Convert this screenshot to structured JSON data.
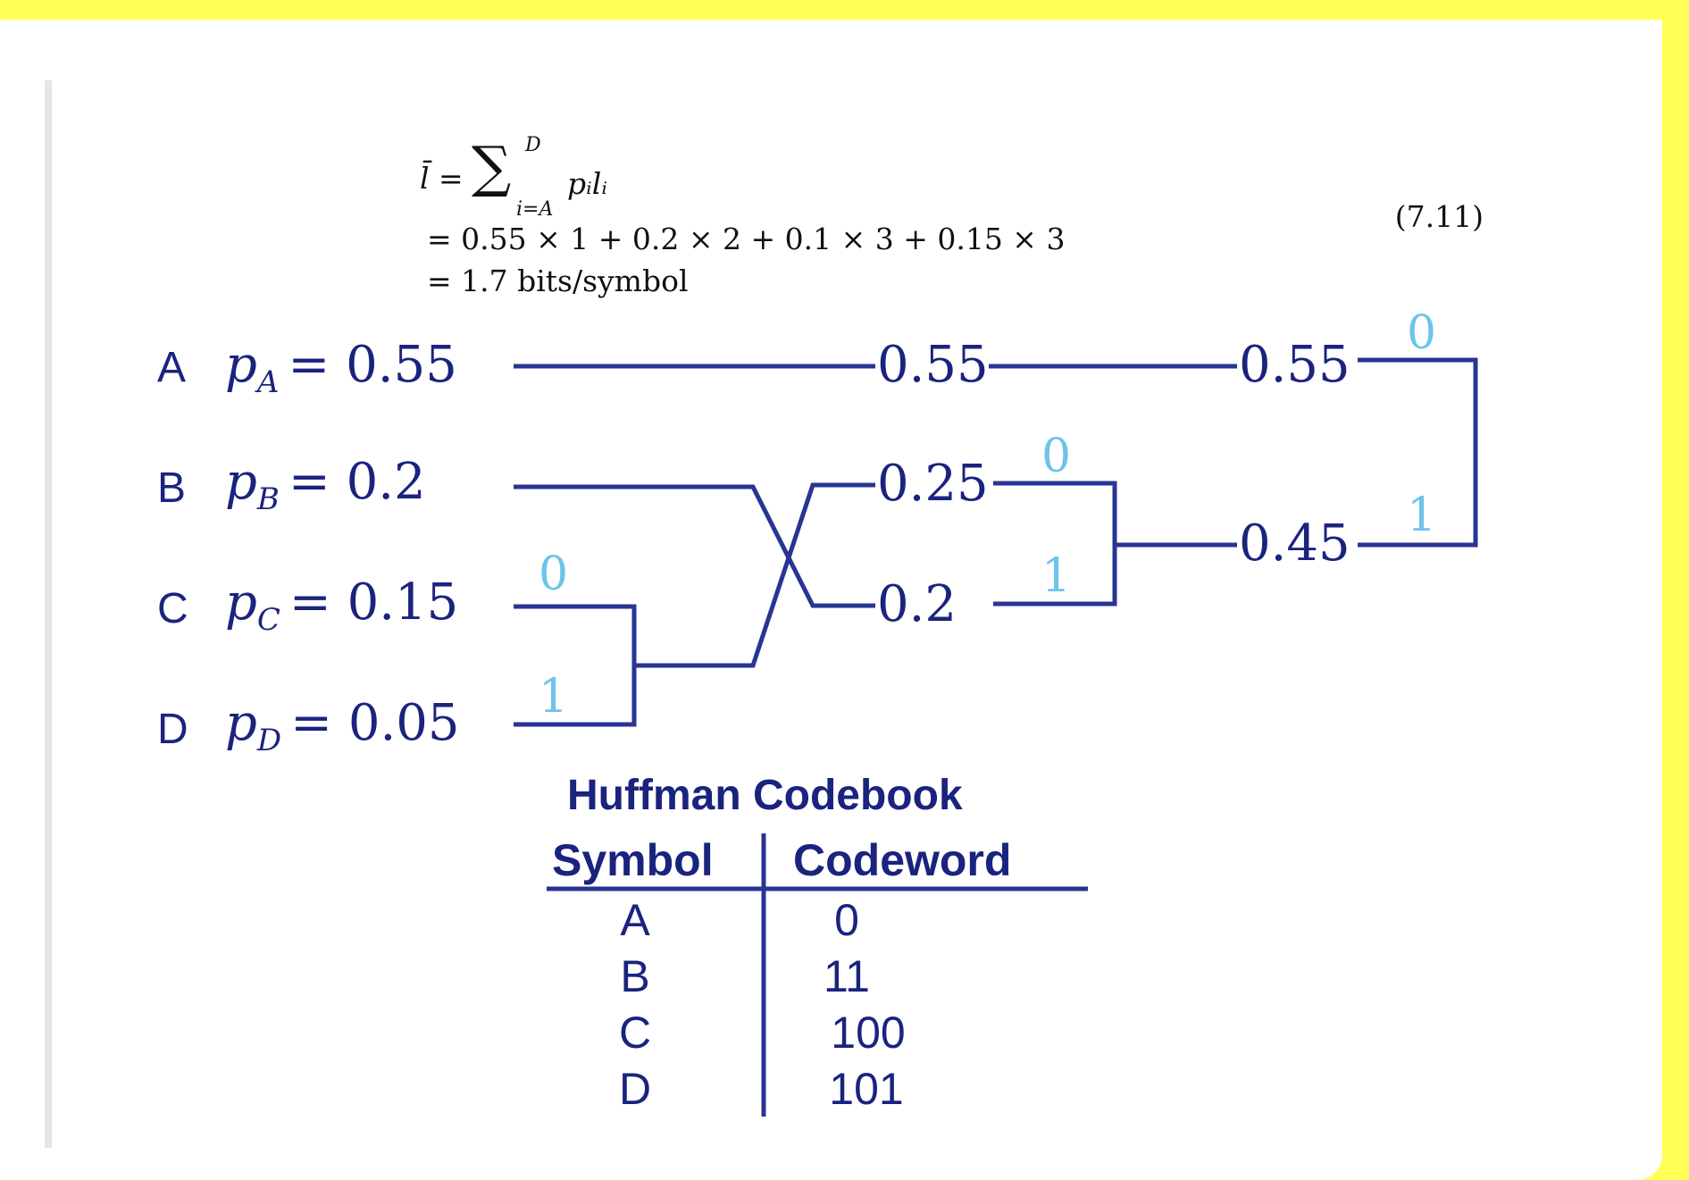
{
  "equation": {
    "line1_lhs": "l̄ =",
    "line1_sum_top": "D",
    "line1_sum_bottom": "i=A",
    "line1_term": "pᵢlᵢ",
    "line2": "= 0.55 × 1 + 0.2 × 2 + 0.1 × 3 + 0.15 × 3",
    "line3": "= 1.7 bits/symbol",
    "number": "(7.11)"
  },
  "symbols": [
    {
      "letter": "A",
      "var": "p",
      "sub": "A",
      "value": "= 0.55"
    },
    {
      "letter": "B",
      "var": "p",
      "sub": "B",
      "value": "= 0.2"
    },
    {
      "letter": "C",
      "var": "p",
      "sub": "C",
      "value": "= 0.15"
    },
    {
      "letter": "D",
      "var": "p",
      "sub": "D",
      "value": "= 0.05"
    }
  ],
  "stage1_nodes": [
    "0.55",
    "0.25",
    "0.2"
  ],
  "stage2_nodes": [
    "0.55",
    "0.45"
  ],
  "bits": {
    "cd_upper": "0",
    "cd_lower": "1",
    "mid_upper": "0",
    "mid_lower": "1",
    "final_upper": "0",
    "final_lower": "1"
  },
  "codebook": {
    "title": "Huffman Codebook",
    "headers": [
      "Symbol",
      "Codeword"
    ],
    "rows": [
      {
        "symbol": "A",
        "code": "0"
      },
      {
        "symbol": "B",
        "code": "11"
      },
      {
        "symbol": "C",
        "code": "100"
      },
      {
        "symbol": "D",
        "code": "101"
      }
    ]
  },
  "colors": {
    "background": "#ffff55",
    "wire": "#283593",
    "text_dark": "#1a237e",
    "bit": "#6ec3ea"
  }
}
